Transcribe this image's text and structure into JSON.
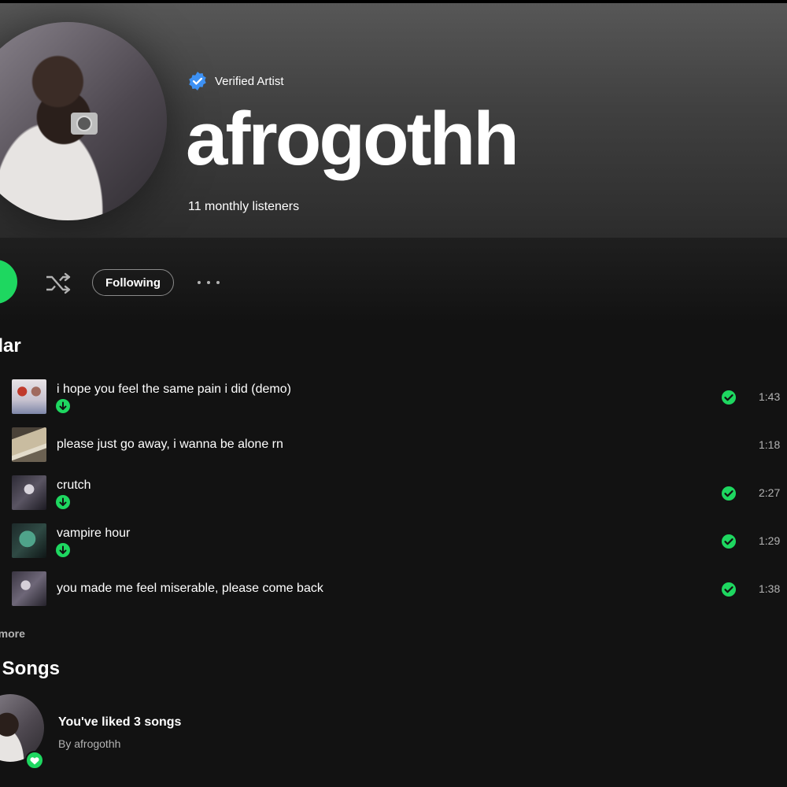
{
  "header": {
    "verified_label": "Verified Artist",
    "artist_name": "afrogothh",
    "monthly_listeners": "11 monthly listeners"
  },
  "actions": {
    "follow_label": "Following"
  },
  "popular": {
    "title": "pular",
    "see_more": "e more",
    "tracks": [
      {
        "title": "i hope you feel the same pain i did (demo)",
        "duration": "1:43",
        "downloaded": true,
        "liked": true
      },
      {
        "title": "please just go away, i wanna be alone rn",
        "duration": "1:18",
        "downloaded": false,
        "liked": false
      },
      {
        "title": "crutch",
        "duration": "2:27",
        "downloaded": true,
        "liked": true
      },
      {
        "title": "vampire hour",
        "duration": "1:29",
        "downloaded": true,
        "liked": true
      },
      {
        "title": "you made me feel miserable, please come back",
        "duration": "1:38",
        "downloaded": false,
        "liked": true
      }
    ]
  },
  "liked_songs": {
    "title": "ed Songs",
    "count_label": "You've liked 3 songs",
    "by_label": "By afrogothh"
  },
  "colors": {
    "accent": "#1ed760",
    "verified": "#3d91f4",
    "background": "#121212",
    "muted_text": "#b3b3b3"
  }
}
